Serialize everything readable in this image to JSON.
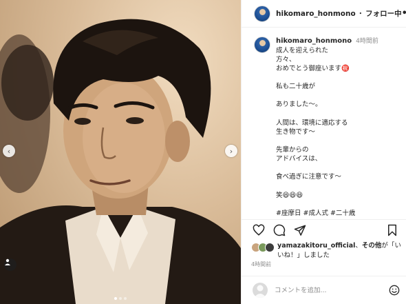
{
  "header": {
    "username": "hikomaro_honmono",
    "separator": "・",
    "follow_status": "フォロー中",
    "more_icon": "more-horizontal-icon"
  },
  "caption": {
    "username": "hikomaro_honmono",
    "time": "4時間前",
    "text": "成人を迎えられた\n方々、\nおめでとう御座います㊗️\n\n私も二十歳が\n\nありました〜。\n\n人間は、環境に適応する\n生き物です〜\n\n先輩からの\nアドバイスは、\n\n食べ過ぎに注意です〜\n\n笑😆😆😆\n\n#座摩日 #成人式 #二十歳"
  },
  "actions": {
    "like_icon": "heart-icon",
    "comment_icon": "comment-icon",
    "share_icon": "send-icon",
    "save_icon": "bookmark-icon"
  },
  "likes": {
    "user": "yamazakitoru_official",
    "middle": "、",
    "others": "その他",
    "suffix": "が「いいね！」しました"
  },
  "post_time": "4時間前",
  "comment": {
    "placeholder": "コメントを追加...",
    "emoji_icon": "smiley-icon"
  },
  "photo": {
    "prev_icon": "chevron-left-icon",
    "next_icon": "chevron-right-icon",
    "tag_icon": "user-tag-icon",
    "carousel_total": 3,
    "carousel_current": 1
  },
  "colors": {
    "text": "#262626",
    "muted": "#8e8e8e",
    "border": "#efefef",
    "sepia_light": "#f1dcc0",
    "sepia_dark": "#2a1f17"
  }
}
